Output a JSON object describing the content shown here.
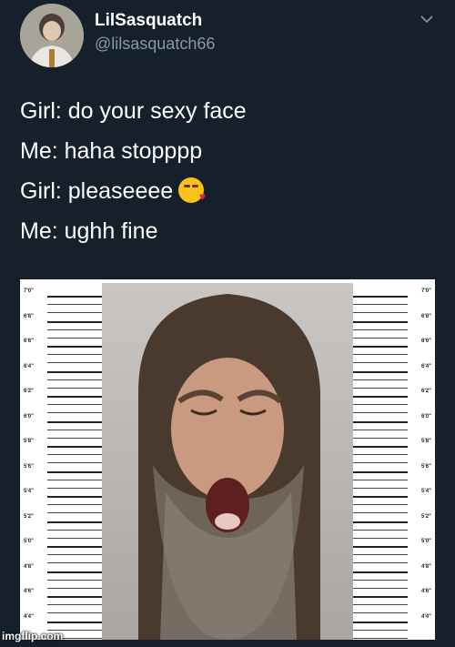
{
  "tweet": {
    "author": {
      "display_name": "LilSasquatch",
      "handle": "@lilsasquatch66",
      "avatar_icon": "avatar-photo"
    },
    "menu_icon": "chevron-down-icon",
    "lines": [
      "Girl: do your sexy face",
      "Me: haha stopppp",
      "Girl: pleaseeee",
      "Me: ughh fine"
    ],
    "emoji_after_line_3": "face-blowing-a-kiss-emoji",
    "media": {
      "description_icon": "mugshot-height-chart-photo",
      "height_labels": [
        "7'0\"",
        "6'8\"",
        "6'6\"",
        "6'4\"",
        "6'2\"",
        "6'0\"",
        "5'8\"",
        "5'6\"",
        "5'4\"",
        "5'2\"",
        "5'0\"",
        "4'8\"",
        "4'6\"",
        "4'4\""
      ]
    }
  },
  "watermark": "imgflip.com",
  "colors": {
    "background": "#15202b",
    "text_primary": "#ffffff",
    "text_secondary": "#8899a6"
  }
}
